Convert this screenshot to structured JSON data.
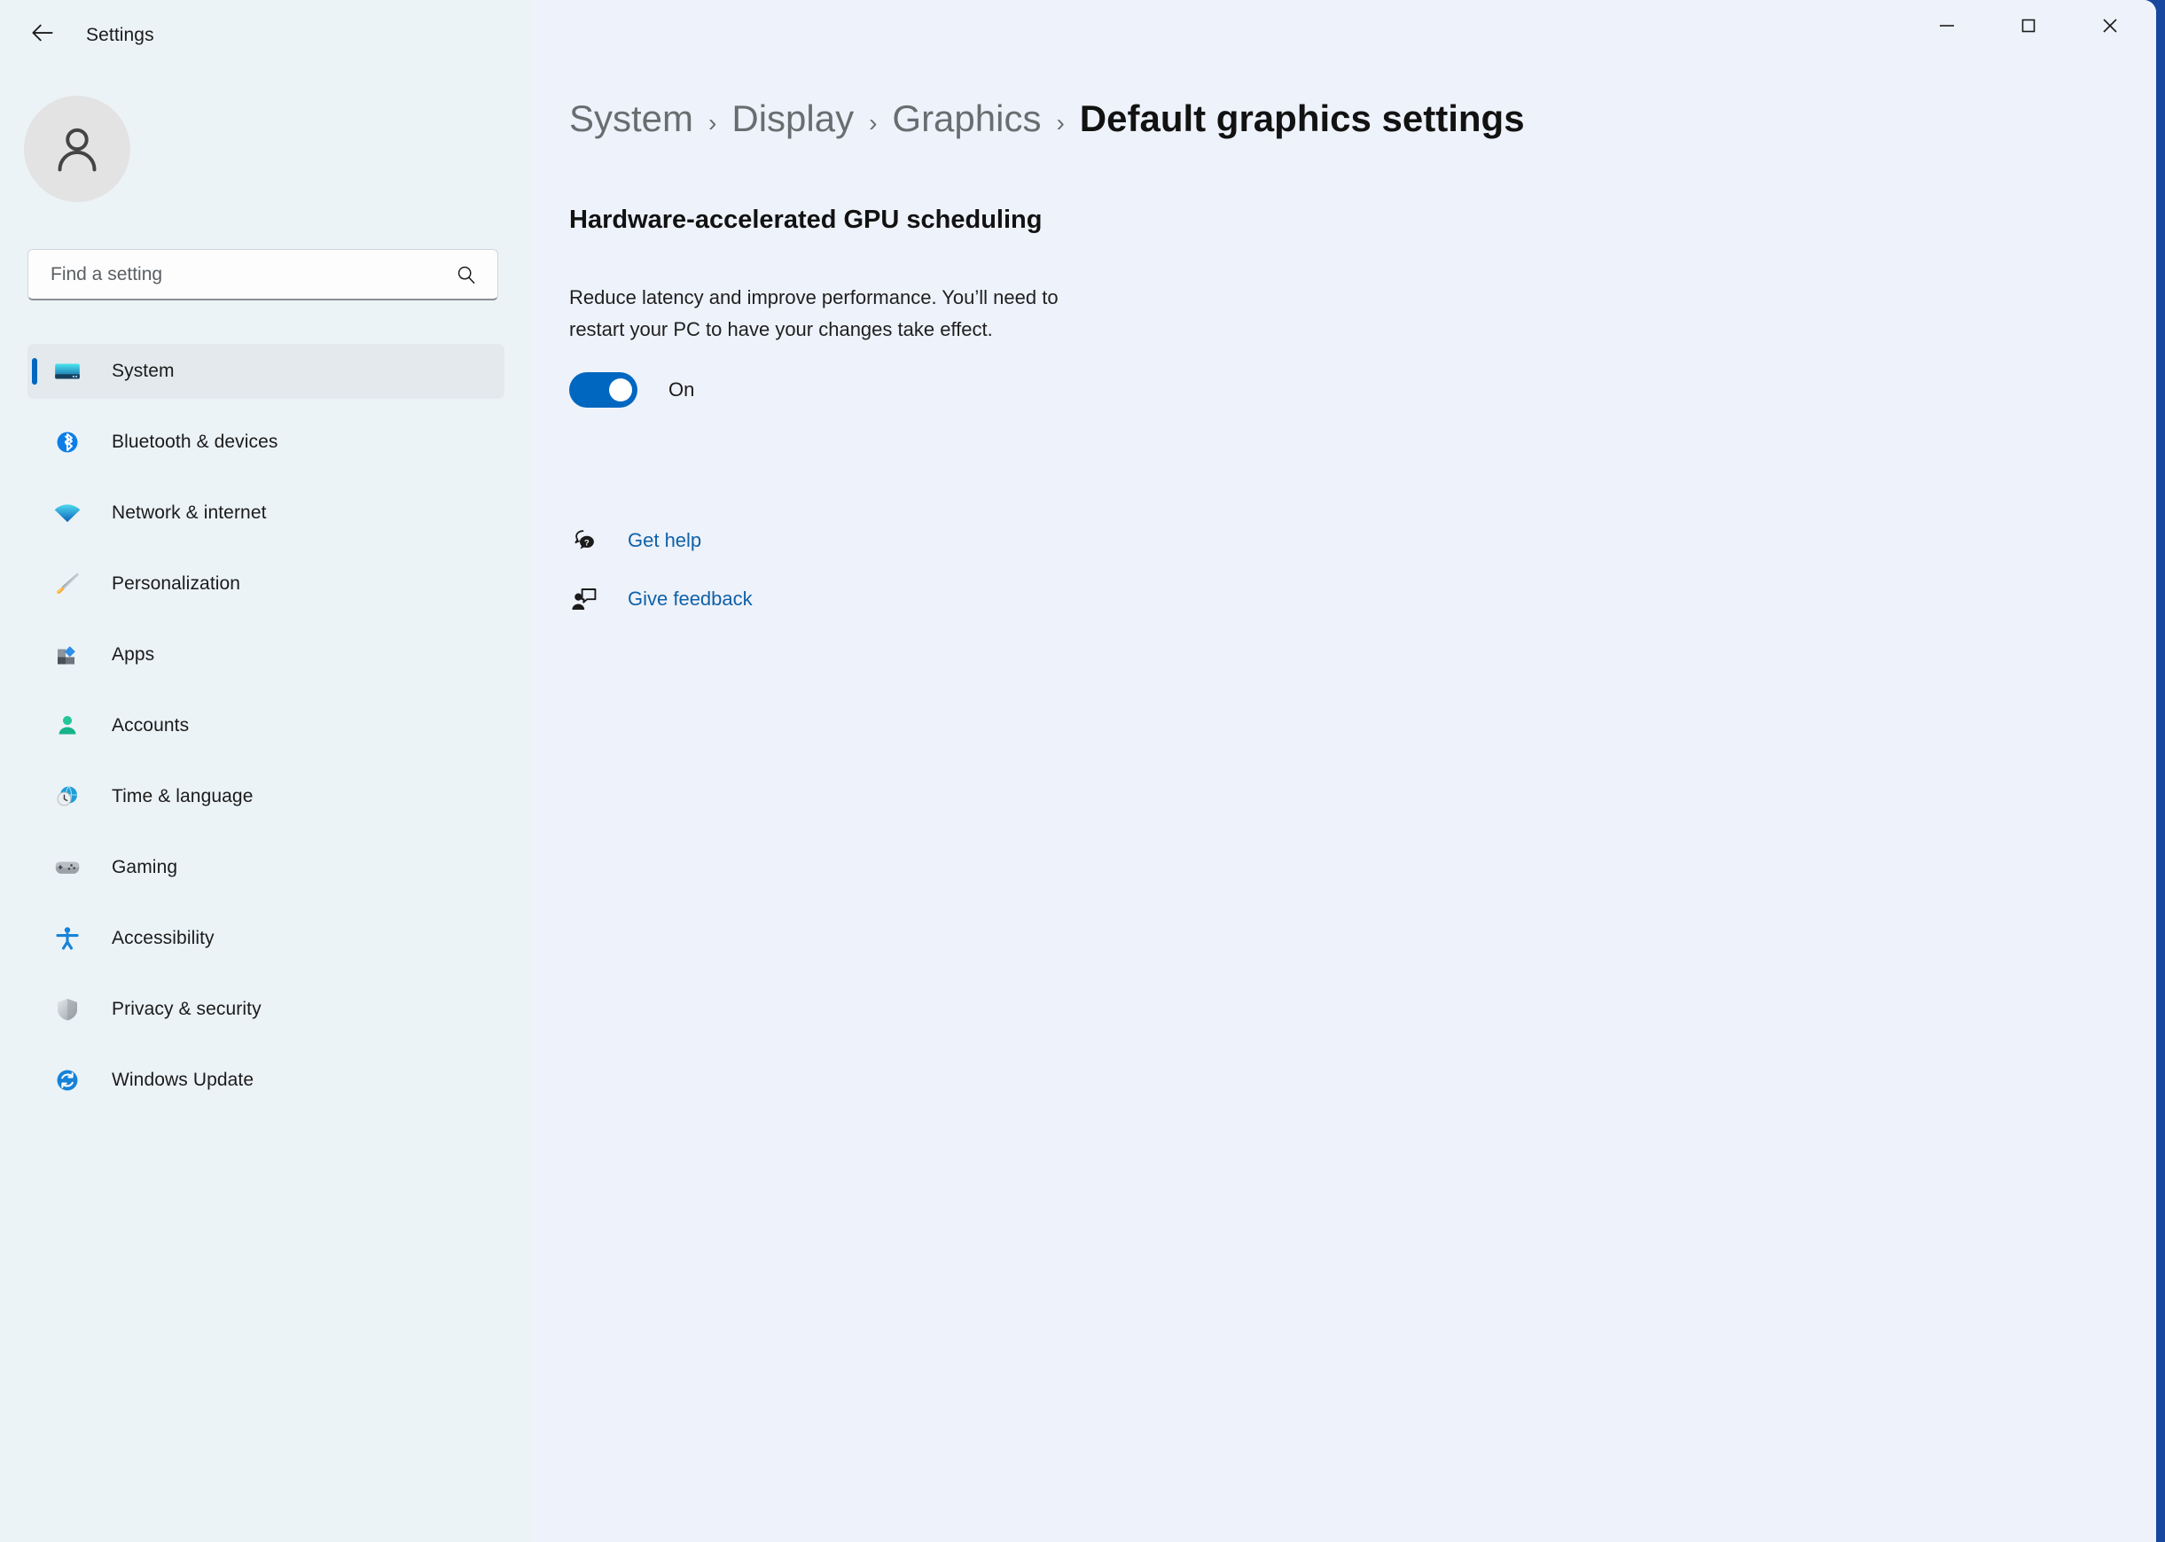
{
  "window": {
    "app_title": "Settings",
    "back_icon": "back-arrow-icon",
    "controls": {
      "minimize": "minimize-icon",
      "maximize": "maximize-icon",
      "close": "close-icon"
    },
    "desktop_accent": "#17479e"
  },
  "sidebar": {
    "avatar_icon": "person-avatar-icon",
    "search": {
      "placeholder": "Find a setting",
      "value": "",
      "icon": "search-icon"
    },
    "items": [
      {
        "label": "System",
        "icon": "system-monitor-icon",
        "selected": true
      },
      {
        "label": "Bluetooth & devices",
        "icon": "bluetooth-icon",
        "selected": false
      },
      {
        "label": "Network & internet",
        "icon": "wifi-icon",
        "selected": false
      },
      {
        "label": "Personalization",
        "icon": "paintbrush-icon",
        "selected": false
      },
      {
        "label": "Apps",
        "icon": "apps-blocks-icon",
        "selected": false
      },
      {
        "label": "Accounts",
        "icon": "account-person-icon",
        "selected": false
      },
      {
        "label": "Time & language",
        "icon": "clock-globe-icon",
        "selected": false
      },
      {
        "label": "Gaming",
        "icon": "gamepad-icon",
        "selected": false
      },
      {
        "label": "Accessibility",
        "icon": "accessibility-icon",
        "selected": false
      },
      {
        "label": "Privacy & security",
        "icon": "shield-icon",
        "selected": false
      },
      {
        "label": "Windows Update",
        "icon": "update-refresh-icon",
        "selected": false
      }
    ],
    "selection_accent": "#0067c0"
  },
  "main": {
    "breadcrumb": {
      "separator": "›",
      "items": [
        "System",
        "Display",
        "Graphics",
        "Default graphics settings"
      ]
    },
    "section": {
      "title": "Hardware-accelerated GPU scheduling",
      "description": "Reduce latency and improve performance. You’ll need to restart your PC to have your changes take effect.",
      "toggle": {
        "state_label": "On",
        "checked": true,
        "on_color": "#0067c0"
      }
    },
    "links": [
      {
        "label": "Get help",
        "icon": "help-question-bubble-icon"
      },
      {
        "label": "Give feedback",
        "icon": "feedback-person-bubble-icon"
      }
    ],
    "link_color": "#1061a8"
  }
}
